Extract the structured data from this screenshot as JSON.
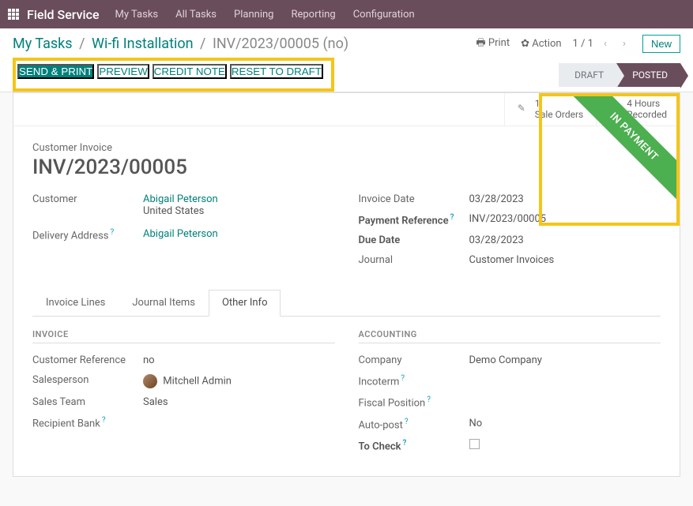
{
  "app": {
    "name": "Field Service"
  },
  "nav": {
    "my_tasks": "My Tasks",
    "all_tasks": "All Tasks",
    "planning": "Planning",
    "reporting": "Reporting",
    "configuration": "Configuration"
  },
  "breadcrumb": {
    "level1": "My Tasks",
    "level2": "Wi-fi Installation",
    "level3": "INV/2023/00005 (no)"
  },
  "controls": {
    "print": "Print",
    "action": "Action",
    "pager": "1 / 1",
    "new": "New"
  },
  "buttons": {
    "send_print": "SEND & PRINT",
    "preview": "PREVIEW",
    "credit_note": "CREDIT NOTE",
    "reset_draft": "RESET TO DRAFT"
  },
  "status": {
    "draft": "DRAFT",
    "posted": "POSTED"
  },
  "stats": {
    "sale_orders_count": "1",
    "sale_orders_label": "Sale Orders",
    "hours_count": "4 Hours",
    "hours_label": "Recorded"
  },
  "ribbon": "IN PAYMENT",
  "doc": {
    "type_label": "Customer Invoice",
    "name": "INV/2023/00005",
    "customer_label": "Customer",
    "customer_name": "Abigail Peterson",
    "customer_country": "United States",
    "delivery_addr_label": "Delivery Address",
    "delivery_addr_value": "Abigail Peterson",
    "invoice_date_label": "Invoice Date",
    "invoice_date": "03/28/2023",
    "payment_ref_label": "Payment Reference",
    "payment_ref": "INV/2023/00005",
    "due_date_label": "Due Date",
    "due_date": "03/28/2023",
    "journal_label": "Journal",
    "journal": "Customer Invoices"
  },
  "tabs": {
    "invoice_lines": "Invoice Lines",
    "journal_items": "Journal Items",
    "other_info": "Other Info"
  },
  "sections": {
    "invoice": "INVOICE",
    "accounting": "ACCOUNTING"
  },
  "other": {
    "customer_ref_label": "Customer Reference",
    "customer_ref": "no",
    "salesperson_label": "Salesperson",
    "salesperson": "Mitchell Admin",
    "sales_team_label": "Sales Team",
    "sales_team": "Sales",
    "recipient_bank_label": "Recipient Bank",
    "company_label": "Company",
    "company": "Demo Company",
    "incoterm_label": "Incoterm",
    "fiscal_position_label": "Fiscal Position",
    "auto_post_label": "Auto-post",
    "auto_post": "No",
    "to_check_label": "To Check"
  }
}
